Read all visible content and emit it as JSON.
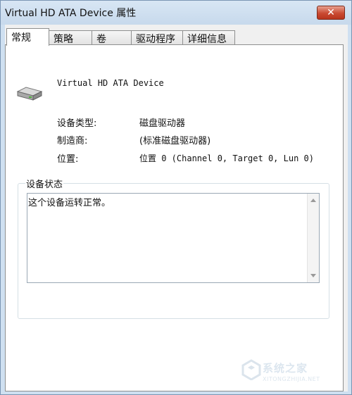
{
  "window": {
    "title": "Virtual HD ATA Device 属性",
    "close_glyph": "✕"
  },
  "tabs": [
    {
      "label": "常规",
      "active": true
    },
    {
      "label": "策略",
      "active": false
    },
    {
      "label": "卷",
      "active": false
    },
    {
      "label": "驱动程序",
      "active": false
    },
    {
      "label": "详细信息",
      "active": false
    }
  ],
  "device": {
    "icon": "drive-icon",
    "name": "Virtual HD ATA Device"
  },
  "properties": [
    {
      "label": "设备类型:",
      "value": "磁盘驱动器"
    },
    {
      "label": "制造商:",
      "value": "(标准磁盘驱动器)"
    },
    {
      "label": "位置:",
      "value": "位置 0 (Channel 0, Target 0, Lun 0)"
    }
  ],
  "status": {
    "group_title": "设备状态",
    "text": "这个设备运转正常。"
  },
  "watermark": {
    "text": "系统之家",
    "sub": "XITONGZHIJIA.NET"
  },
  "colors": {
    "frame": "#cfe0f1",
    "close_button": "#c94a32",
    "panel": "#ffffff"
  }
}
